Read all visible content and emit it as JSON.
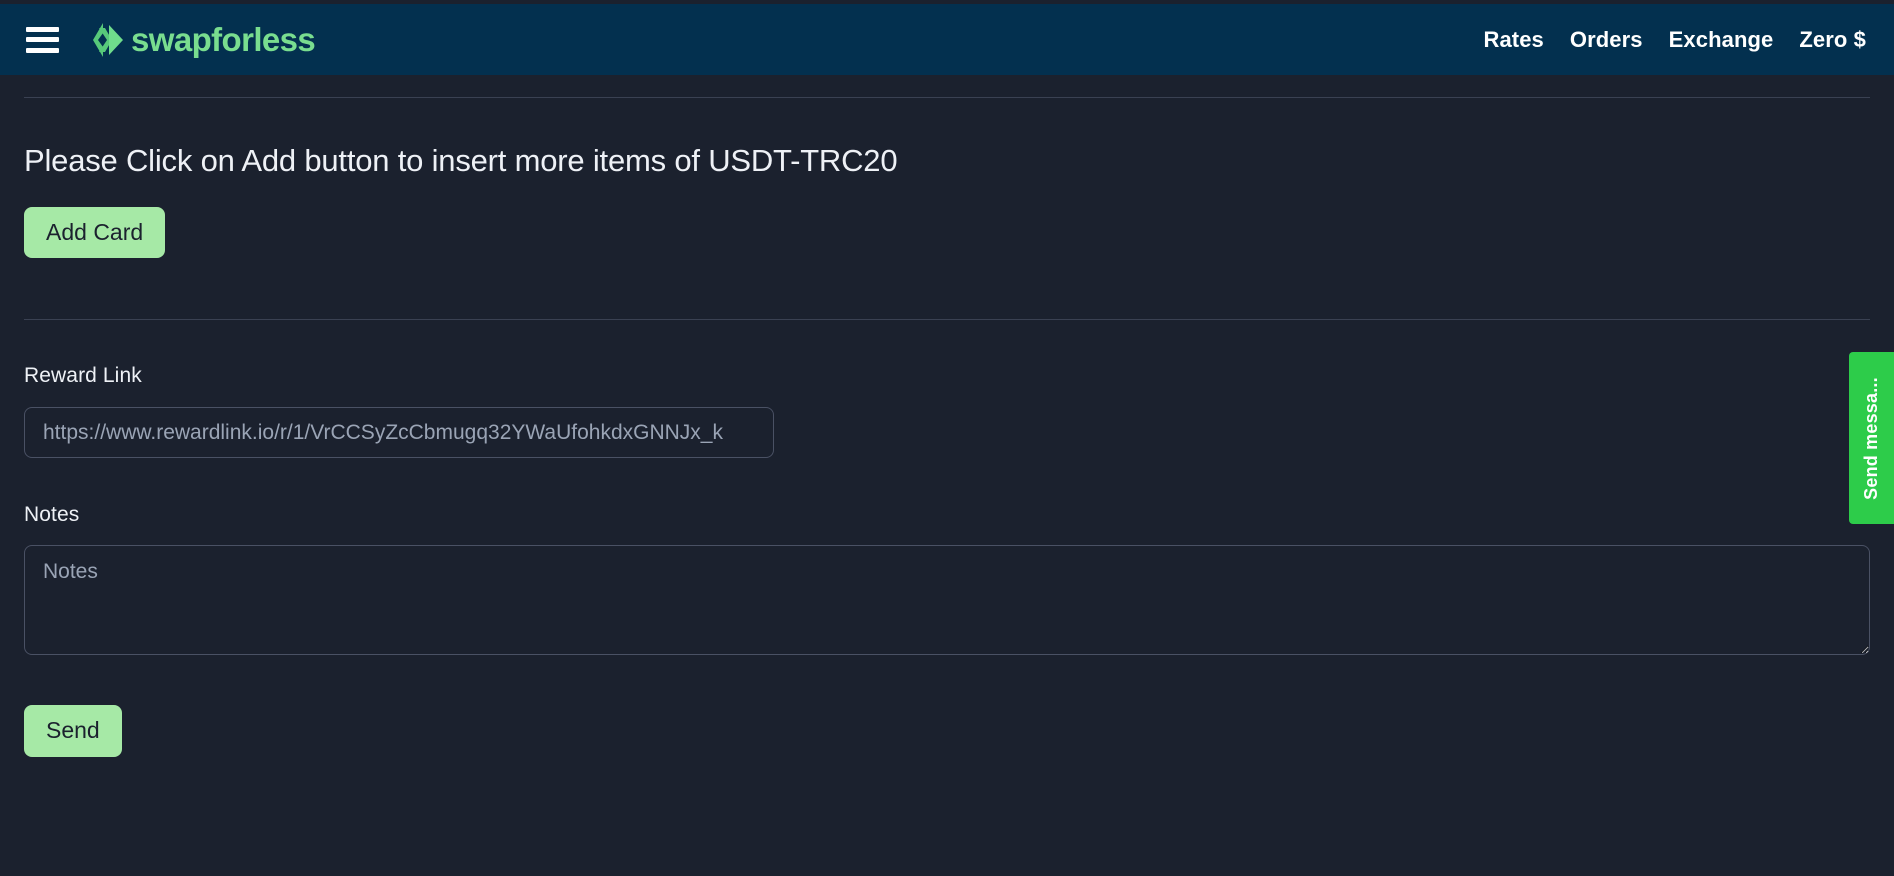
{
  "theme": {
    "page_bg": "#1b212e",
    "navbar_bg": "#03304f",
    "brand_green": "#79dd8f",
    "button_green": "#a6e9a6",
    "chat_green": "#2dcc4a",
    "text_light": "#eef1f6",
    "text_muted": "#9aa4b5",
    "border": "#4a5164"
  },
  "navbar": {
    "menu_icon": "hamburger-menu-icon",
    "brand_logo_icon": "swapforless-chevron-logo-icon",
    "brand_name": "swapforless",
    "links": [
      {
        "label": "Rates"
      },
      {
        "label": "Orders"
      },
      {
        "label": "Exchange"
      },
      {
        "label": "Zero $"
      }
    ]
  },
  "main": {
    "headline": "Please Click on Add button to insert more items of USDT-TRC20",
    "add_card_label": "Add Card",
    "reward_link": {
      "label": "Reward Link",
      "value": "https://www.rewardlink.io/r/1/VrCCSyZcCbmugq32YWaUfohkdxGNNJx_k",
      "placeholder": "https://www.rewardlink.io/r/1/VrCCSyZcCbmugq32YWaUfohkdxGNNJx_k"
    },
    "notes": {
      "label": "Notes",
      "value": "",
      "placeholder": "Notes"
    },
    "send_label": "Send"
  },
  "chat_widget": {
    "label": "Send messa..."
  }
}
